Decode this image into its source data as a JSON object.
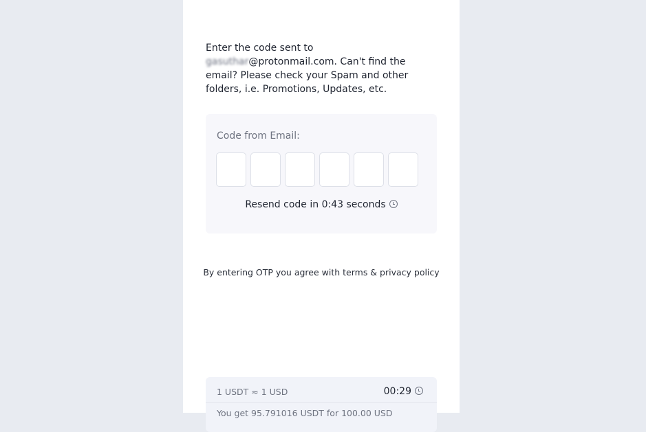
{
  "instructions": {
    "prefix": "Enter the code sent to",
    "email_local": "gasuthar",
    "email_domain": "@protonmail.com.",
    "rest": "Can't find the email? Please check your Spam and other folders, i.e. Promotions, Updates, etc."
  },
  "code_card": {
    "label": "Code from Email:",
    "digits": [
      "",
      "",
      "",
      "",
      "",
      ""
    ],
    "resend_text": "Resend code in 0:43 seconds"
  },
  "terms": "By entering OTP you agree with terms & privacy policy",
  "rate": {
    "rate_text": "1 USDT ≈ 1 USD",
    "timer": "00:29",
    "get_text": "You get 95.791016 USDT for 100.00 USD"
  },
  "icons": {
    "resend_clock": "clock-icon",
    "rate_clock": "clock-icon"
  },
  "colors": {
    "page_background": "#e8ebf1",
    "panel_background": "#ffffff",
    "card_background": "#f7f7fb"
  }
}
